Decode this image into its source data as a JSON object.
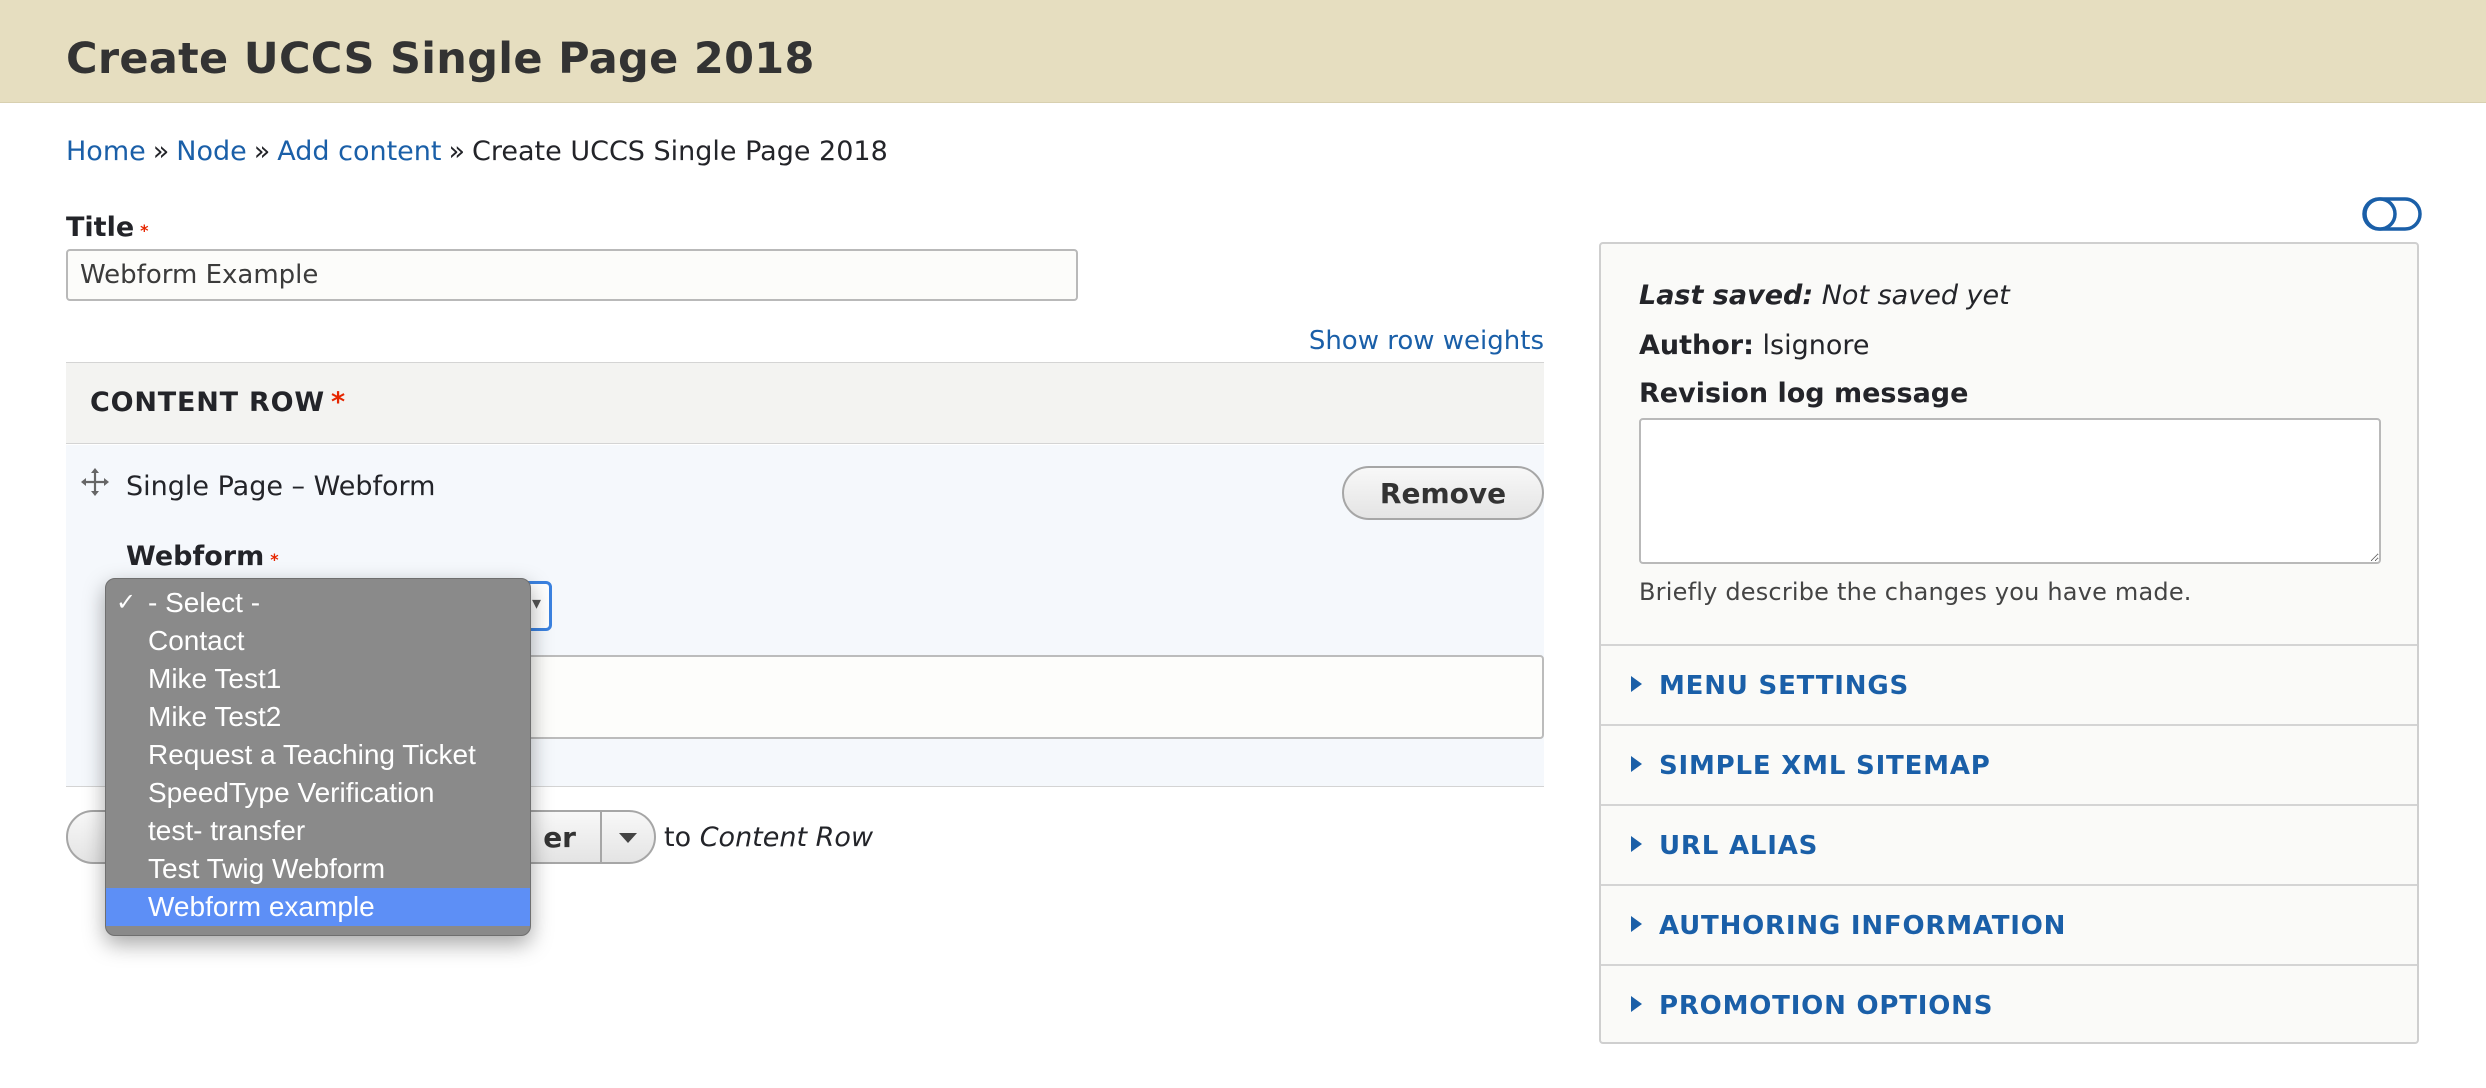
{
  "header": {
    "title": "Create UCCS Single Page 2018"
  },
  "breadcrumb": {
    "items": [
      "Home",
      "Node",
      "Add content"
    ],
    "current": "Create UCCS Single Page 2018",
    "separator": "»"
  },
  "form": {
    "title_label": "Title",
    "required_mark": "*",
    "title_value": "Webform Example",
    "show_row_weights": "Show row weights",
    "content_row": {
      "heading": "CONTENT ROW",
      "paragraph_label": "Single Page – Webform",
      "remove_label": "Remove",
      "webform_label": "Webform",
      "add_button_visible": "er",
      "to_text": "to",
      "to_target": "Content Row"
    }
  },
  "dropdown": {
    "checked_option": "- Select -",
    "highlighted_option": "Webform example",
    "options": [
      "- Select -",
      "Contact",
      "Mike Test1",
      "Mike Test2",
      "Request a Teaching Ticket",
      "SpeedType Verification",
      "test- transfer",
      "Test Twig Webform",
      "Webform example"
    ],
    "check_glyph": "✓"
  },
  "sidebar": {
    "last_saved_label": "Last saved:",
    "last_saved_value": "Not saved yet",
    "author_label": "Author:",
    "author_value": "lsignore",
    "revision_label": "Revision log message",
    "revision_hint": "Briefly describe the changes you have made.",
    "sections": [
      "MENU SETTINGS",
      "SIMPLE XML SITEMAP",
      "URL ALIAS",
      "AUTHORING INFORMATION",
      "PROMOTION OPTIONS"
    ]
  },
  "colors": {
    "header_bg": "#e6dec0",
    "link": "#1a5fa8",
    "required": "#e62600",
    "dropdown_bg": "#8a8a8a",
    "dropdown_highlight": "#5d8ff6"
  },
  "icons": {
    "drag": "drag-handle-icon",
    "toggle": "toggle-icon",
    "check": "checkmark-icon",
    "section_arrow": "triangle-right-icon"
  }
}
